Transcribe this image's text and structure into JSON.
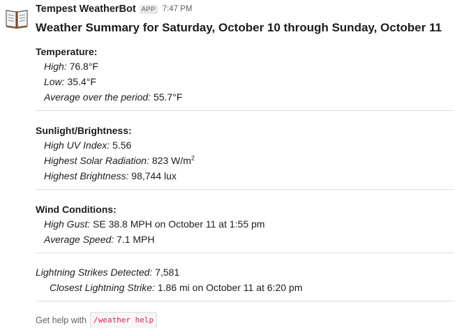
{
  "message": {
    "bot_name": "Tempest WeatherBot",
    "app_badge": "APP",
    "timestamp": "7:47 PM",
    "avatar_icon": "open-book-icon"
  },
  "summary": {
    "title": "Weather Summary for Saturday, October 10 through Sunday, October 11",
    "temperature": {
      "heading": "Temperature:",
      "high_label": "High:",
      "high_value": " 76.8°F",
      "low_label": "Low:",
      "low_value": " 35.4°F",
      "avg_label": "Average over the period:",
      "avg_value": " 55.7°F"
    },
    "sunlight": {
      "heading": "Sunlight/Brightness:",
      "uv_label": "High UV Index:",
      "uv_value": " 5.56",
      "solar_label": "Highest Solar Radiation:",
      "solar_value": " 823 W/m",
      "solar_sup": "2",
      "brightness_label": "Highest Brightness:",
      "brightness_value": " 98,744 lux"
    },
    "wind": {
      "heading": "Wind Conditions:",
      "gust_label": "High Gust:",
      "gust_value": " SE 38.8 MPH on October 11 at 1:55 pm",
      "avg_label": "Average Speed:",
      "avg_value": " 7.1 MPH"
    },
    "lightning": {
      "detected_label": "Lightning Strikes Detected:",
      "detected_value": " 7,581",
      "closest_label": "Closest Lightning Strike:",
      "closest_value": " 1.86 mi on October 11 at 6:20 pm"
    },
    "footer": {
      "help_text": "Get help with",
      "command": "/weather help"
    }
  }
}
